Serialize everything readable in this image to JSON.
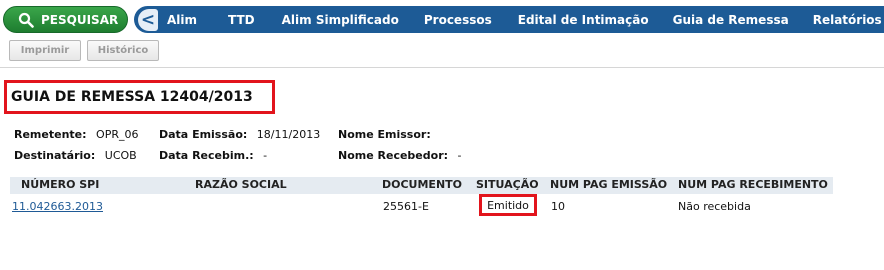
{
  "nav": {
    "search_label": "PESQUISAR",
    "back_label": "<",
    "items": [
      "Alim",
      "TTD",
      "Alim Simplificado",
      "Processos",
      "Edital de Intimação",
      "Guia de Remessa",
      "Relatórios"
    ]
  },
  "toolbar": {
    "print_label": "Imprimir",
    "history_label": "Histórico"
  },
  "page": {
    "title": "GUIA DE REMESSA 12404/2013"
  },
  "info": {
    "remetente_label": "Remetente:",
    "remetente_value": "OPR_06",
    "data_emissao_label": "Data Emissão:",
    "data_emissao_value": "18/11/2013",
    "nome_emissor_label": "Nome Emissor:",
    "nome_emissor_value": "",
    "destinatario_label": "Destinatário:",
    "destinatario_value": "UCOB",
    "data_recebim_label": "Data Recebim.:",
    "data_recebim_value": "-",
    "nome_recebedor_label": "Nome Recebedor:",
    "nome_recebedor_value": "-"
  },
  "table": {
    "headers": [
      "NÚMERO SPI",
      "RAZÃO SOCIAL",
      "DOCUMENTO",
      "SITUAÇÃO",
      "NUM PAG EMISSÃO",
      "NUM PAG RECEBIMENTO"
    ],
    "rows": [
      {
        "numero_spi": "11.042663.2013",
        "razao_social": "",
        "documento": "25561-E",
        "situacao": "Emitido",
        "num_pag_emissao": "10",
        "num_pag_recebimento": "Não recebida"
      }
    ]
  },
  "colors": {
    "nav_blue": "#1d5b96",
    "search_green": "#2e9a41",
    "highlight_red": "#e2141c",
    "link_blue": "#1f5a96"
  }
}
